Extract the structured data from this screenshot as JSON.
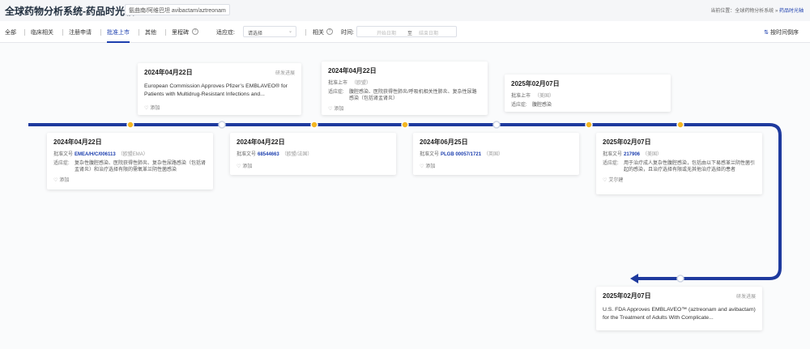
{
  "header": {
    "title": "全球药物分析系统-药品时光轴",
    "drug_tag": "氨曲南/阿维巴坦 avibactam/aztreonam",
    "breadcrumb_prefix": "当前位置：",
    "breadcrumb_path": "全球药物分析系统",
    "breadcrumb_sep": "»",
    "breadcrumb_current": "药品时光轴"
  },
  "toolbar": {
    "tabs": [
      {
        "label": "全部",
        "active": false
      },
      {
        "label": "临床相关",
        "active": false
      },
      {
        "label": "注册申请",
        "active": false
      },
      {
        "label": "批准上市",
        "active": true
      },
      {
        "label": "其他",
        "active": false
      },
      {
        "label": "里程碑",
        "active": false
      }
    ],
    "indication_label": "适应症:",
    "indication_value": "请选择",
    "related_label": "相关",
    "time_label": "时间:",
    "date_start_placeholder": "开始日期",
    "date_sep": "至",
    "date_end_placeholder": "结束日期",
    "sort_label": "按时间倒序",
    "icons": {
      "help": "help-circle-icon",
      "chevron": "chevron-down-icon",
      "sort": "sort-icon"
    }
  },
  "colors": {
    "timeline": "#1e3a9e",
    "marker_filled": "#f3b622",
    "marker_empty": "#ffffff",
    "link": "#1e40af"
  },
  "events": {
    "top": [
      {
        "date": "2024年04月22日",
        "kind": "研发进展",
        "text": "European Commission Approves Pfizer’s EMBLAVEO® for Patients with Multidrug-Resistant Infections and...",
        "fav": "添加"
      },
      {
        "date": "2024年04月22日",
        "approval_label": "批准上市",
        "approval_note": "（欧盟）",
        "indication_label": "适应症:",
        "indication": "腹腔感染、医院获得性肺炎/呼吸机相关性肺炎、复杂性尿路感染（包括肾盂肾炎）",
        "fav": "添加"
      },
      {
        "date": "2025年02月07日",
        "approval_label": "批准上市",
        "approval_note": "（美国）",
        "indication_label": "适应症:",
        "indication": "腹腔感染"
      }
    ],
    "bottom": [
      {
        "date": "2024年04月22日",
        "approval_label": "批准文号",
        "approval_no": "EMEA/H/C/006113",
        "approval_note": "（欧盟EMA）",
        "indication_label": "适应症:",
        "indication": "复杂性腹腔感染、医院获得性肺炎、复杂性尿路感染（包括肾盂肾炎）和治疗选择有限的需氧革兰阴性菌感染",
        "fav": "添加"
      },
      {
        "date": "2024年04月22日",
        "approval_label": "批准文号",
        "approval_no": "68544663",
        "approval_note": "（欧盟/法国）",
        "fav": "添加"
      },
      {
        "date": "2024年06月25日",
        "approval_label": "批准文号",
        "approval_no": "PLGB 00057/1721",
        "approval_note": "（英国）",
        "fav": "添加"
      },
      {
        "date": "2025年02月07日",
        "approval_label": "批准文号",
        "approval_no": "217906",
        "approval_note": "（美国）",
        "indication_label": "适应症:",
        "indication": "用于治疗成人复杂性腹腔感染，包括由以下易感革兰阴性菌引起的感染，且治疗选择有限或无其他治疗选择的患者",
        "fav": "艾尔建"
      },
      {
        "date": "2025年02月07日",
        "kind": "研发进展",
        "text": "U.S. FDA Approves EMBLAVEO™ (aztreonam and avibactam) for the Treatment of Adults With Complicate...",
        "fav": ""
      }
    ]
  },
  "markers": [
    "filled",
    "empty",
    "filled",
    "filled",
    "empty",
    "filled",
    "filled",
    "empty"
  ]
}
